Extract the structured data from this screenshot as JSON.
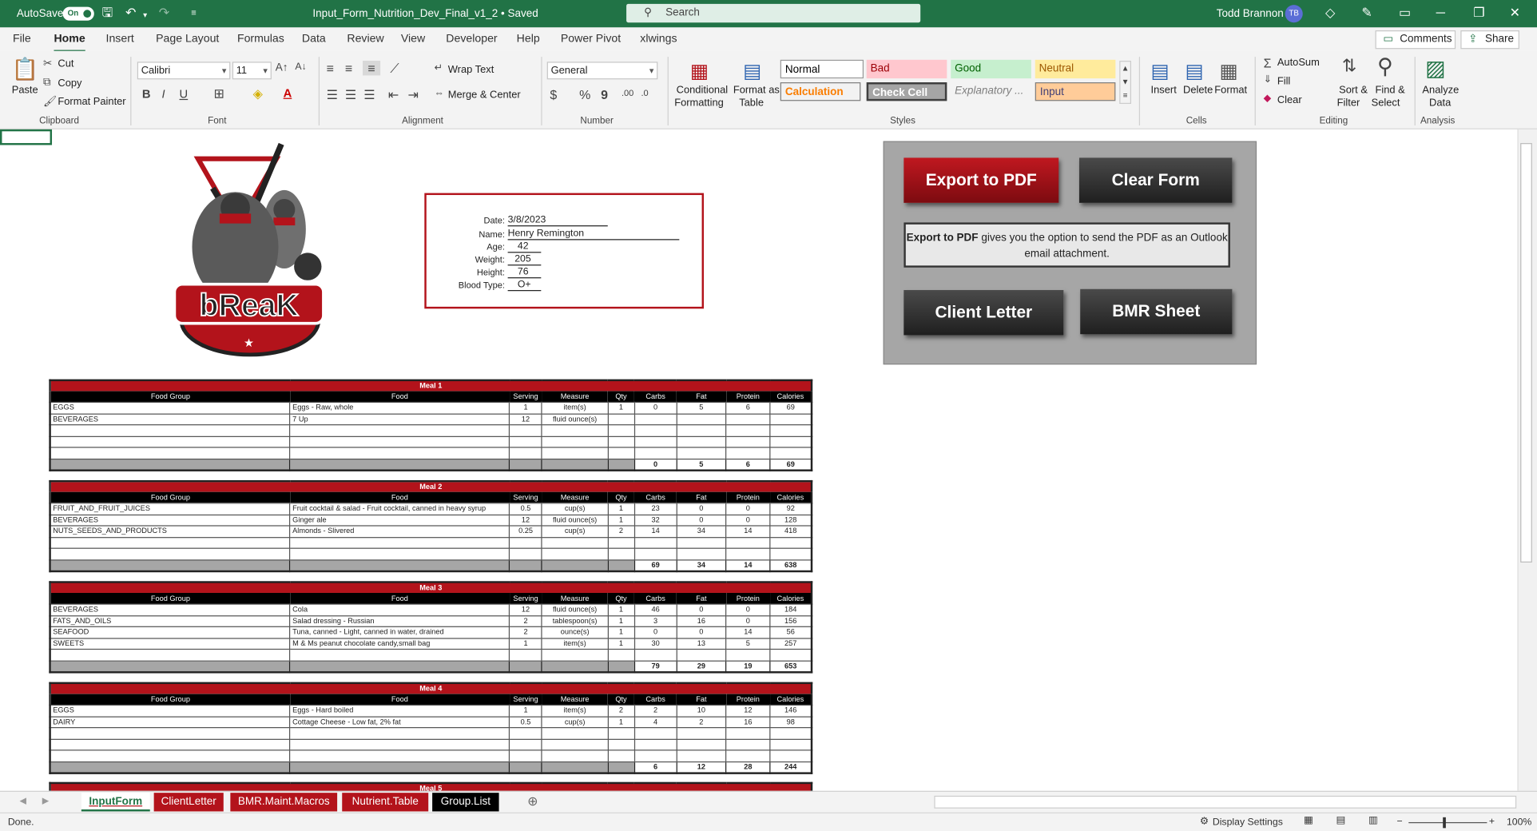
{
  "titlebar": {
    "autosave": "AutoSave",
    "toggle": "On",
    "filename": "Input_Form_Nutrition_Dev_Final_v1_2 • Saved",
    "search": "Search",
    "user": "Todd Brannon",
    "initials": "TB"
  },
  "menu": {
    "tabs": [
      "File",
      "Home",
      "Insert",
      "Page Layout",
      "Formulas",
      "Data",
      "Review",
      "View",
      "Developer",
      "Help",
      "Power Pivot",
      "xlwings"
    ],
    "comments": "Comments",
    "share": "Share"
  },
  "ribbon": {
    "clipboard": {
      "paste": "Paste",
      "cut": "Cut",
      "copy": "Copy",
      "format_painter": "Format Painter",
      "group": "Clipboard"
    },
    "font": {
      "name": "Calibri",
      "size": "11",
      "group": "Font"
    },
    "alignment": {
      "wrap": "Wrap Text",
      "merge": "Merge & Center",
      "group": "Alignment"
    },
    "number": {
      "format": "General",
      "group": "Number"
    },
    "styles": {
      "cond1": "Conditional",
      "cond2": "Formatting",
      "fat1": "Format as",
      "fat2": "Table",
      "normal": "Normal",
      "bad": "Bad",
      "good": "Good",
      "neutral": "Neutral",
      "calculation": "Calculation",
      "check": "Check Cell",
      "explanatory": "Explanatory ...",
      "input": "Input",
      "group": "Styles"
    },
    "cells": {
      "insert": "Insert",
      "delete": "Delete",
      "format": "Format",
      "group": "Cells"
    },
    "editing": {
      "autosum": "AutoSum",
      "fill": "Fill",
      "clear": "Clear",
      "sort1": "Sort &",
      "sort2": "Filter",
      "find1": "Find &",
      "find2": "Select",
      "group": "Editing"
    },
    "analysis": {
      "an1": "Analyze",
      "an2": "Data",
      "group": "Analysis"
    }
  },
  "logo": {
    "text": "bReaK"
  },
  "info": {
    "date_label": "Date:",
    "date": "3/8/2023",
    "name_label": "Name:",
    "name": "Henry Remington",
    "age_label": "Age:",
    "age": "42",
    "weight_label": "Weight:",
    "weight": "205",
    "height_label": "Height:",
    "height": "76",
    "blood_label": "Blood Type:",
    "blood": "O+"
  },
  "panel": {
    "export": "Export to PDF",
    "clear": "Clear Form",
    "note_bold": "Export to PDF",
    "note_rest": " gives you the option to send the PDF as an Outlook email attachment.",
    "letter": "Client Letter",
    "bmr": "BMR Sheet"
  },
  "columns": [
    "Food Group",
    "Food",
    "Serving",
    "Measure",
    "Qty",
    "Carbs",
    "Fat",
    "Protein",
    "Calories"
  ],
  "meals": [
    {
      "title": "Meal 1",
      "rows": [
        [
          "EGGS",
          "Eggs - Raw, whole",
          "1",
          "item(s)",
          "1",
          "0",
          "5",
          "6",
          "69"
        ],
        [
          "BEVERAGES",
          "7 Up",
          "12",
          "fluid ounce(s)",
          "",
          "",
          "",
          "",
          ""
        ],
        [
          "",
          "",
          "",
          "",
          "",
          "",
          "",
          "",
          ""
        ],
        [
          "",
          "",
          "",
          "",
          "",
          "",
          "",
          "",
          ""
        ],
        [
          "",
          "",
          "",
          "",
          "",
          "",
          "",
          "",
          ""
        ]
      ],
      "totals": [
        "0",
        "5",
        "6",
        "69"
      ]
    },
    {
      "title": "Meal 2",
      "rows": [
        [
          "FRUIT_AND_FRUIT_JUICES",
          "Fruit cocktail & salad - Fruit cocktail, canned in heavy syrup",
          "0.5",
          "cup(s)",
          "1",
          "23",
          "0",
          "0",
          "92"
        ],
        [
          "BEVERAGES",
          "Ginger ale",
          "12",
          "fluid ounce(s)",
          "1",
          "32",
          "0",
          "0",
          "128"
        ],
        [
          "NUTS_SEEDS_AND_PRODUCTS",
          "Almonds - Slivered",
          "0.25",
          "cup(s)",
          "2",
          "14",
          "34",
          "14",
          "418"
        ],
        [
          "",
          "",
          "",
          "",
          "",
          "",
          "",
          "",
          ""
        ],
        [
          "",
          "",
          "",
          "",
          "",
          "",
          "",
          "",
          ""
        ]
      ],
      "totals": [
        "69",
        "34",
        "14",
        "638"
      ]
    },
    {
      "title": "Meal 3",
      "rows": [
        [
          "BEVERAGES",
          "Cola",
          "12",
          "fluid ounce(s)",
          "1",
          "46",
          "0",
          "0",
          "184"
        ],
        [
          "FATS_AND_OILS",
          "Salad dressing - Russian",
          "2",
          "tablespoon(s)",
          "1",
          "3",
          "16",
          "0",
          "156"
        ],
        [
          "SEAFOOD",
          "Tuna, canned - Light, canned in water, drained",
          "2",
          "ounce(s)",
          "1",
          "0",
          "0",
          "14",
          "56"
        ],
        [
          "SWEETS",
          "M & Ms peanut chocolate candy,small bag",
          "1",
          "item(s)",
          "1",
          "30",
          "13",
          "5",
          "257"
        ],
        [
          "",
          "",
          "",
          "",
          "",
          "",
          "",
          "",
          ""
        ]
      ],
      "totals": [
        "79",
        "29",
        "19",
        "653"
      ]
    },
    {
      "title": "Meal 4",
      "rows": [
        [
          "EGGS",
          "Eggs - Hard boiled",
          "1",
          "item(s)",
          "2",
          "2",
          "10",
          "12",
          "146"
        ],
        [
          "DAIRY",
          "Cottage Cheese - Low fat, 2% fat",
          "0.5",
          "cup(s)",
          "1",
          "4",
          "2",
          "16",
          "98"
        ],
        [
          "",
          "",
          "",
          "",
          "",
          "",
          "",
          "",
          ""
        ],
        [
          "",
          "",
          "",
          "",
          "",
          "",
          "",
          "",
          ""
        ],
        [
          "",
          "",
          "",
          "",
          "",
          "",
          "",
          "",
          ""
        ]
      ],
      "totals": [
        "6",
        "12",
        "28",
        "244"
      ]
    },
    {
      "title": "Meal 5"
    }
  ],
  "sheet_tabs": [
    "InputForm",
    "ClientLetter",
    "BMR.Maint.Macros",
    "Nutrient.Table",
    "Group.List"
  ],
  "status": {
    "text": "Done.",
    "display": "Display Settings",
    "zoom": "100%"
  }
}
